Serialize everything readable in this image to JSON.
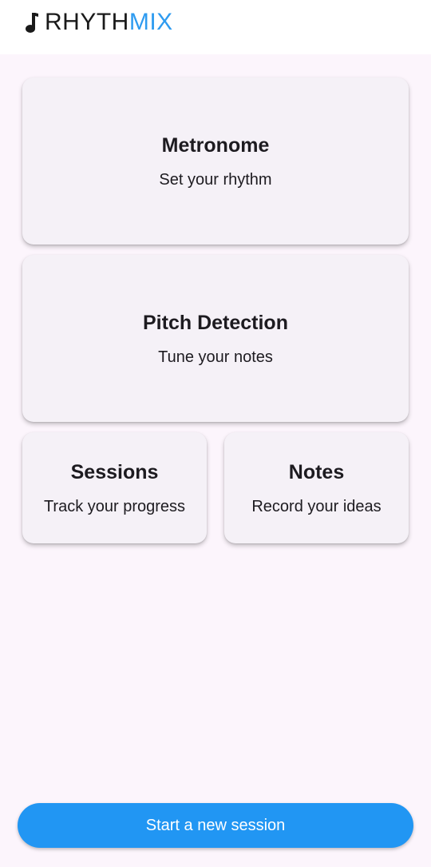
{
  "app": {
    "brand_primary": "RHYTH",
    "brand_accent": "MIX",
    "brand_icon": "music-note-icon",
    "accent_color": "#2e9bf0"
  },
  "cards": {
    "metronome": {
      "title": "Metronome",
      "subtitle": "Set your rhythm"
    },
    "pitch": {
      "title": "Pitch Detection",
      "subtitle": "Tune your notes"
    },
    "sessions": {
      "title": "Sessions",
      "subtitle": "Track your progress"
    },
    "notes": {
      "title": "Notes",
      "subtitle": "Record your ideas"
    }
  },
  "cta": {
    "label": "Start a new session",
    "color": "#2196f3"
  }
}
